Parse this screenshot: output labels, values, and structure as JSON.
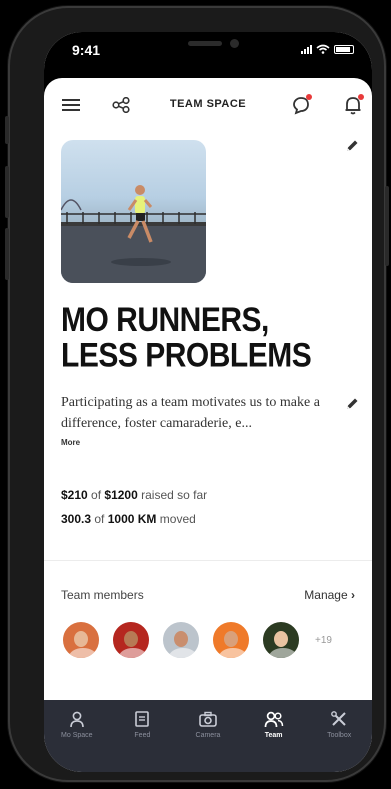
{
  "status_bar": {
    "time": "9:41"
  },
  "header": {
    "title": "TEAM SPACE"
  },
  "team": {
    "name": "MO RUNNERS, LESS PROBLEMS",
    "description": "Participating as a team motivates us to make a difference, foster camaraderie, e...",
    "more_label": "More"
  },
  "stats": {
    "raised_amount": "$210",
    "raised_of": "of",
    "raised_goal": "$1200",
    "raised_suffix": "raised so far",
    "moved_amount": "300.3",
    "moved_of": "of",
    "moved_goal": "1000 KM",
    "moved_suffix": "moved"
  },
  "members": {
    "label": "Team members",
    "manage_label": "Manage",
    "extra_count": "+19",
    "avatars": [
      {
        "name": "member-1",
        "bg": "#d9703f",
        "skin": "#e7b896"
      },
      {
        "name": "member-2",
        "bg": "#b5271f",
        "skin": "#b77a55"
      },
      {
        "name": "member-3",
        "bg": "#bcc4cc",
        "skin": "#c98e6e"
      },
      {
        "name": "member-4",
        "bg": "#ef7a2a",
        "skin": "#d9a07a"
      },
      {
        "name": "member-5",
        "bg": "#2c3b22",
        "skin": "#e9c3a1"
      }
    ]
  },
  "nav": [
    {
      "label": "Mo Space",
      "icon": "person-icon"
    },
    {
      "label": "Feed",
      "icon": "feed-icon"
    },
    {
      "label": "Camera",
      "icon": "camera-icon"
    },
    {
      "label": "Team",
      "icon": "team-icon",
      "active": true
    },
    {
      "label": "Toolbox",
      "icon": "toolbox-icon"
    }
  ],
  "colors": {
    "nav_bg": "#2b2e38",
    "notification_dot": "#e83a3a"
  }
}
